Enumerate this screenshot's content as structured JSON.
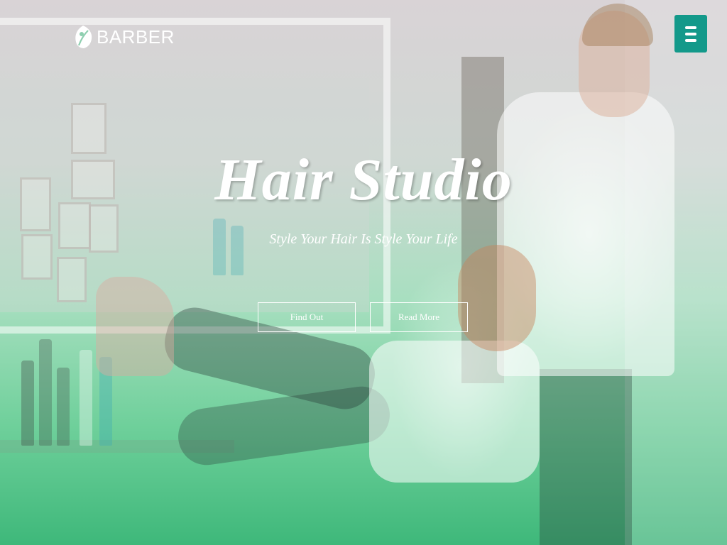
{
  "header": {
    "logo_text": "BARBER",
    "logo_icon": "barber-leaf-icon",
    "menu_icon": "hamburger-menu-icon"
  },
  "hero": {
    "title": "Hair Studio",
    "subtitle": "Style Your Hair Is Style Your Life",
    "buttons": [
      {
        "label": "Find Out"
      },
      {
        "label": "Read More"
      }
    ]
  },
  "colors": {
    "accent": "#13998a",
    "gradient_bottom": "#3eb87a",
    "text": "#ffffff"
  }
}
